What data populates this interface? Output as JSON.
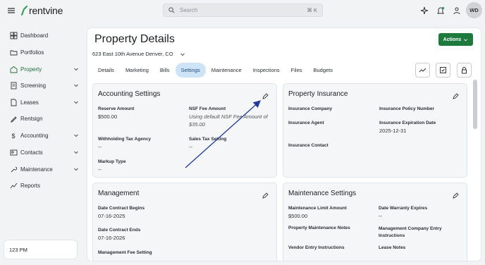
{
  "app": {
    "logo_text": "rentvine",
    "search_placeholder": "Search",
    "search_shortcut": "⌘ K",
    "avatar_initials": "WD"
  },
  "sidebar": {
    "items": [
      {
        "label": "Dashboard",
        "icon": "dashboard-icon",
        "chevron": false
      },
      {
        "label": "Portfolios",
        "icon": "folder-icon",
        "chevron": false
      },
      {
        "label": "Property",
        "icon": "property-icon",
        "chevron": true,
        "active": true
      },
      {
        "label": "Screening",
        "icon": "screening-icon",
        "chevron": true
      },
      {
        "label": "Leases",
        "icon": "leases-icon",
        "chevron": true
      },
      {
        "label": "Rentsign",
        "icon": "rentsign-icon",
        "chevron": false
      },
      {
        "label": "Accounting",
        "icon": "dollar-icon",
        "chevron": true
      },
      {
        "label": "Contacts",
        "icon": "contacts-icon",
        "chevron": true
      },
      {
        "label": "Maintenance",
        "icon": "wrench-icon",
        "chevron": true
      },
      {
        "label": "Reports",
        "icon": "reports-icon",
        "chevron": false
      }
    ],
    "time": "123 PM"
  },
  "page": {
    "title": "Property Details",
    "address": "623 East 10th Avenue Denver, CO",
    "actions_label": "Actions",
    "tabs": [
      "Details",
      "Marketing",
      "Bills",
      "Settings",
      "Maintenance",
      "Inspections",
      "Files",
      "Budgets"
    ],
    "active_tab": "Settings"
  },
  "accounting": {
    "title": "Accounting Settings",
    "reserve_label": "Reserve Amount",
    "reserve_value": "$500.00",
    "nsf_label": "NSF Fee Amount",
    "nsf_value": "Using default NSF Fee Amount of $35.00",
    "withholding_label": "Withholding Tax Agency",
    "withholding_value": "--",
    "sales_tax_label": "Sales Tax Setting",
    "sales_tax_value": "--",
    "markup_label": "Markup Type",
    "markup_value": "--"
  },
  "insurance": {
    "title": "Property Insurance",
    "company_label": "Insurance Company",
    "policy_label": "Insurance Policy Number",
    "agent_label": "Insurance Agent",
    "expiration_label": "Insurance Expiration Date",
    "expiration_value": "2025-12-31",
    "contact_label": "Insurance Contact"
  },
  "management": {
    "title": "Management",
    "begins_label": "Date Contract Begins",
    "begins_value": "07-16-2025",
    "ends_label": "Date Contract Ends",
    "ends_value": "07-16-2026",
    "fee_label": "Management Fee Setting"
  },
  "maintenance": {
    "title": "Maintenance Settings",
    "limit_label": "Maintenance Limit Amount",
    "limit_value": "$500.00",
    "warranty_label": "Date Warranty Expires",
    "warranty_value": "--",
    "notes_label": "Property Maintenance Notes",
    "mgmt_entry_label": "Management Company Entry Instructions",
    "vendor_label": "Vendor Entry Instructions",
    "lease_notes_label": "Lease Notes"
  },
  "colors": {
    "brand_green": "#1d7a3c",
    "active_tab_bg": "#cfe3f7",
    "annotation_arrow": "#1f3a9e"
  }
}
